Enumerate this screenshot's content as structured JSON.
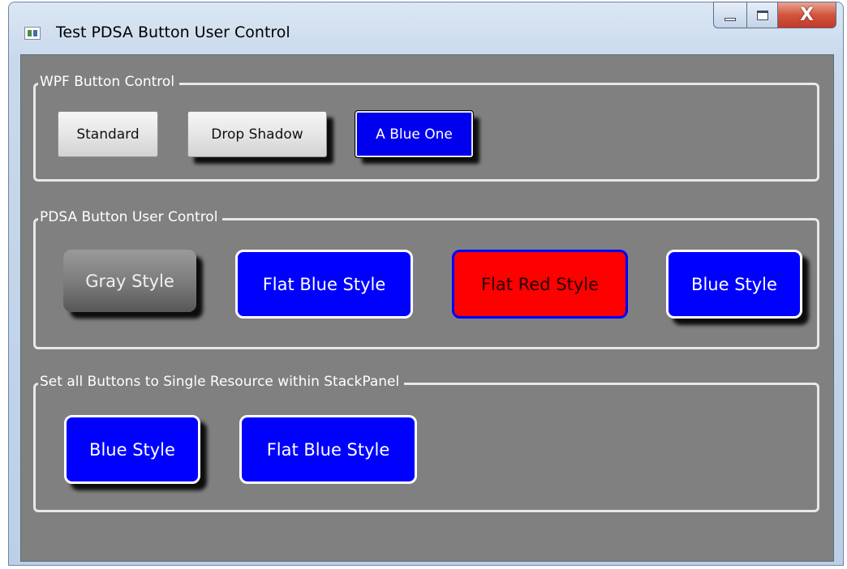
{
  "window": {
    "title": "Test PDSA Button User Control",
    "controls": {
      "minimize": "minimize",
      "maximize": "maximize",
      "close": "X"
    }
  },
  "groups": [
    {
      "label": "WPF Button Control",
      "buttons": [
        {
          "label": "Standard",
          "style": "standard"
        },
        {
          "label": "Drop Shadow",
          "style": "drop-shadow"
        },
        {
          "label": "A Blue One",
          "style": "blue"
        }
      ]
    },
    {
      "label": "PDSA Button User Control",
      "buttons": [
        {
          "label": "Gray Style",
          "style": "gray"
        },
        {
          "label": "Flat Blue Style",
          "style": "flat-blue"
        },
        {
          "label": "Flat Red Style",
          "style": "flat-red"
        },
        {
          "label": "Blue Style",
          "style": "blue"
        }
      ]
    },
    {
      "label": "Set all Buttons to Single Resource within StackPanel",
      "buttons": [
        {
          "label": "Blue Style",
          "style": "blue"
        },
        {
          "label": "Flat Blue Style",
          "style": "flat-blue"
        }
      ]
    }
  ],
  "colors": {
    "client_background": "#808080",
    "blue": "#0000FF",
    "red": "#FF0000",
    "group_border": "#E8E8E8"
  }
}
